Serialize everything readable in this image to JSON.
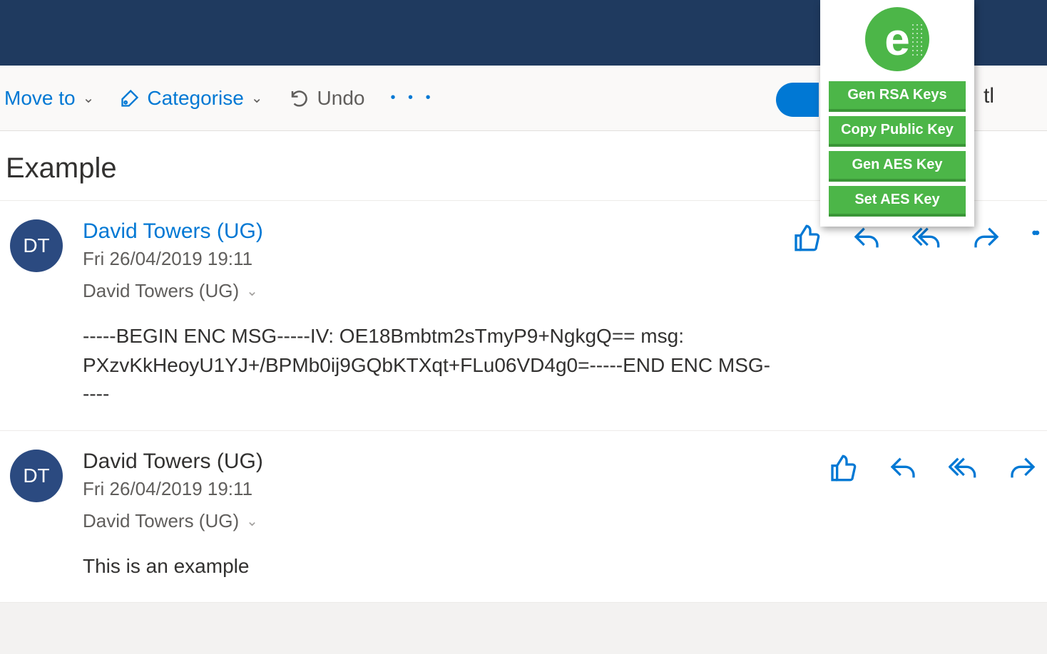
{
  "toolbar": {
    "move_to": "Move to",
    "categorise": "Categorise",
    "undo": "Undo",
    "right_fragment": "tl"
  },
  "extension": {
    "logo_letter": "e",
    "buttons": [
      "Gen RSA Keys",
      "Copy Public Key",
      "Gen AES Key",
      "Set AES Key"
    ]
  },
  "subject": "Example",
  "messages": [
    {
      "avatar_initials": "DT",
      "sender": "David Towers (UG)",
      "sender_blue": true,
      "date": "Fri 26/04/2019 19:11",
      "recipients": "David Towers (UG)",
      "body": "-----BEGIN ENC MSG-----IV: OE18Bmbtm2sTmyP9+NgkgQ== msg: PXzvKkHeoyU1YJ+/BPMb0ij9GQbKTXqt+FLu06VD4g0=-----END ENC MSG-----",
      "show_more": true
    },
    {
      "avatar_initials": "DT",
      "sender": "David Towers (UG)",
      "sender_blue": false,
      "date": "Fri 26/04/2019 19:11",
      "recipients": "David Towers (UG)",
      "body": "This is an example",
      "show_more": false
    }
  ]
}
